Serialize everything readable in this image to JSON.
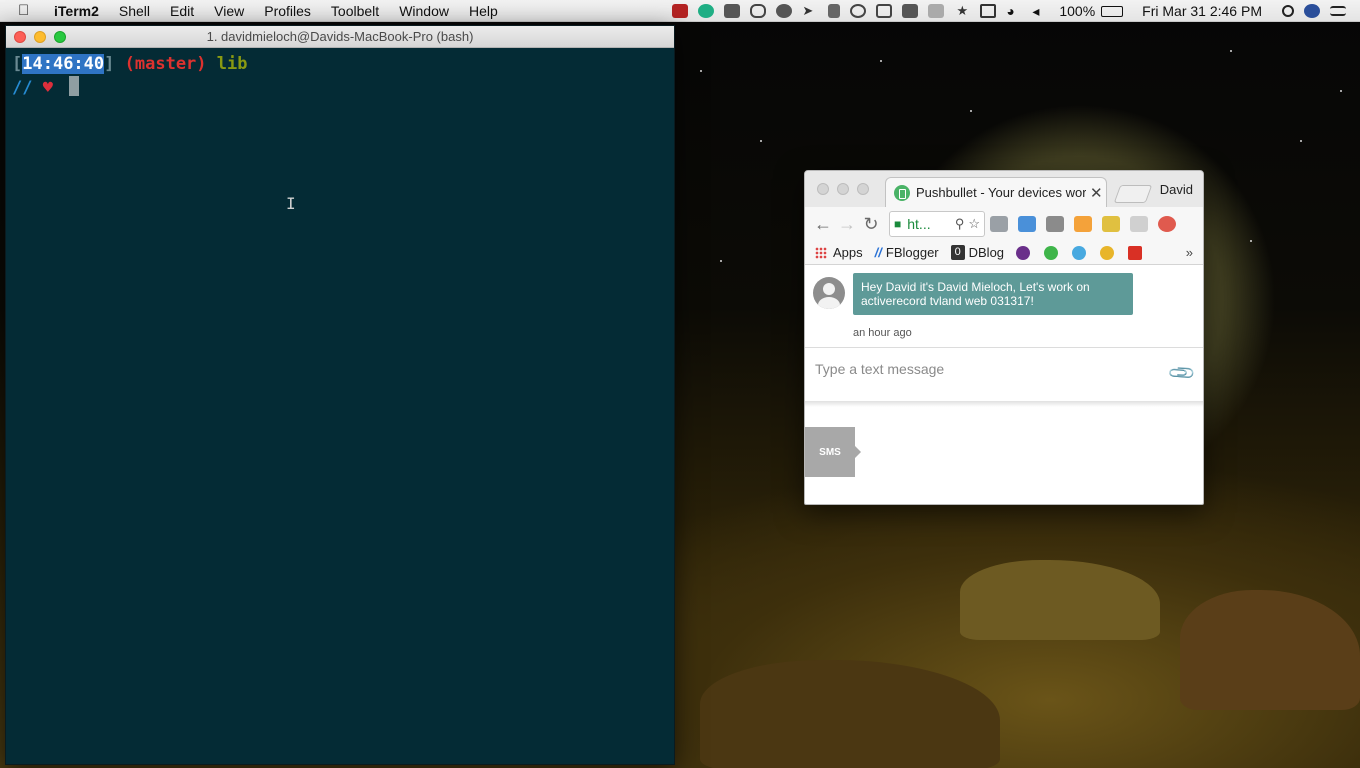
{
  "menubar": {
    "app": "iTerm2",
    "items": [
      "Shell",
      "Edit",
      "View",
      "Profiles",
      "Toolbelt",
      "Window",
      "Help"
    ],
    "status_icons": [
      "film-icon",
      "grammarly-icon",
      "keyboard-icon",
      "glasses-icon",
      "evernote-icon",
      "location-icon",
      "tree-icon",
      "circle-icon",
      "screenshot-icon",
      "layers-icon",
      "stack-icon",
      "bluetooth-icon",
      "airplay-icon",
      "wifi-icon",
      "volume-icon"
    ],
    "battery": "100%",
    "datetime": "Fri Mar 31  2:46 PM"
  },
  "iterm": {
    "title": "1. davidmieloch@Davids-MacBook-Pro (bash)",
    "prompt": {
      "open_bracket": "[",
      "time": "14:46:40",
      "close_bracket": "]",
      "branch": "(master)",
      "dir": "lib",
      "slashes": "//",
      "heart": "♥"
    },
    "cursor_glyph": "I"
  },
  "chrome": {
    "tab_title": "Pushbullet - Your devices working together",
    "profile": "David",
    "omnibox_text": "ht...",
    "bookmarks": {
      "apps": "Apps",
      "fblogger": "FBlogger",
      "dblog_mark": "0",
      "dblog": "DBlog",
      "more": "»"
    },
    "extension_colors": [
      "#9aa0a6",
      "#4a90d9",
      "#8b8b8b",
      "#f4a23a",
      "#e0c040",
      "#d0d0d0",
      "#e05a4e"
    ],
    "bookmark_icon_colors": [
      "#6a2f8a",
      "#3fb54a",
      "#48a9e0",
      "#e8b52a",
      "#d93025"
    ]
  },
  "pushbullet": {
    "message": "Hey David it's David Mieloch, Let's work on activerecord tvland web 031317!",
    "time": "an hour ago",
    "composer_placeholder": "Type a text message",
    "sms_label": "SMS"
  }
}
